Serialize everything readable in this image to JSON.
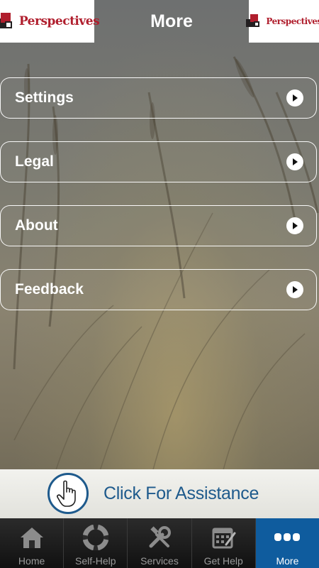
{
  "header": {
    "title": "More",
    "logo_left_text": "Perspectives",
    "logo_right_text": "Perspectives"
  },
  "menu": {
    "items": [
      {
        "label": "Settings"
      },
      {
        "label": "Legal"
      },
      {
        "label": "About"
      },
      {
        "label": "Feedback"
      }
    ]
  },
  "assistance": {
    "label": "Click For Assistance",
    "icon": "pointing-hand-icon"
  },
  "tabbar": {
    "active": "More",
    "tabs": [
      {
        "label": "Home",
        "icon": "home-icon"
      },
      {
        "label": "Self-Help",
        "icon": "lifebuoy-icon"
      },
      {
        "label": "Services",
        "icon": "tools-icon"
      },
      {
        "label": "Get Help",
        "icon": "calendar-icon"
      },
      {
        "label": "More",
        "icon": "more-dots-icon"
      }
    ]
  },
  "colors": {
    "brand_red": "#b01e2d",
    "accent_blue": "#1e5a8c",
    "active_tab": "#0f5c9e"
  }
}
